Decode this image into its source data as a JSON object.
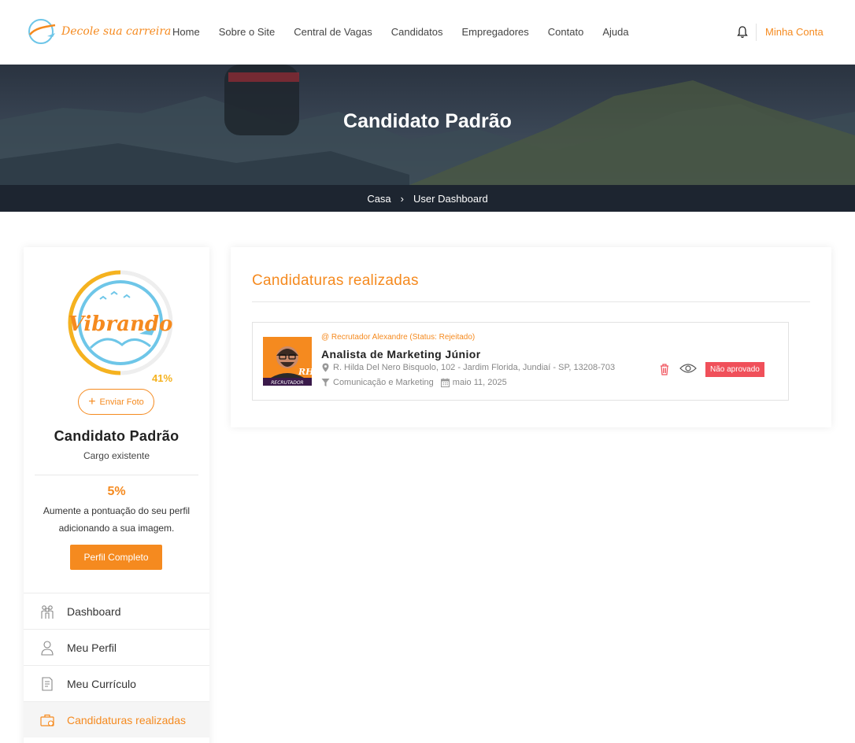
{
  "header": {
    "logo_text": "Decole sua carreira",
    "nav": [
      "Home",
      "Sobre o Site",
      "Central de Vagas",
      "Candidatos",
      "Empregadores",
      "Contato",
      "Ajuda"
    ],
    "account_label": "Minha Conta"
  },
  "hero": {
    "title": "Candidato Padrão",
    "breadcrumb_home": "Casa",
    "breadcrumb_current": "User Dashboard"
  },
  "profile": {
    "completion_badge": "41%",
    "upload_button": "Enviar Foto",
    "name": "Candidato Padrão",
    "role": "Cargo existente",
    "score": "5%",
    "score_text": "Aumente a pontuação do seu perfil adicionando a sua imagem.",
    "complete_button": "Perfil Completo"
  },
  "menu": [
    {
      "label": "Dashboard",
      "icon": "users-icon"
    },
    {
      "label": "Meu Perfil",
      "icon": "user-icon"
    },
    {
      "label": "Meu Currículo",
      "icon": "resume-icon"
    },
    {
      "label": "Candidaturas realizadas",
      "icon": "briefcase-icon",
      "active": true
    }
  ],
  "applications": {
    "title": "Candidaturas realizadas",
    "items": [
      {
        "recruiter": "@ Recrutador Alexandre (Status: Rejeitado)",
        "job_title": "Analista de Marketing Júnior",
        "address": "R. Hilda Del Nero Bisquolo, 102 - Jardim Florida, Jundiaí - SP, 13208-703",
        "category": "Comunicação e Marketing",
        "date": "maio 11, 2025",
        "status": "Não aprovado",
        "avatar_badge": "RH",
        "avatar_caption": "RECRUTADOR"
      }
    ]
  },
  "colors": {
    "accent": "#f58a1f",
    "status_rejected": "#f0505a",
    "breadcrumb_bg": "#1d2530"
  }
}
